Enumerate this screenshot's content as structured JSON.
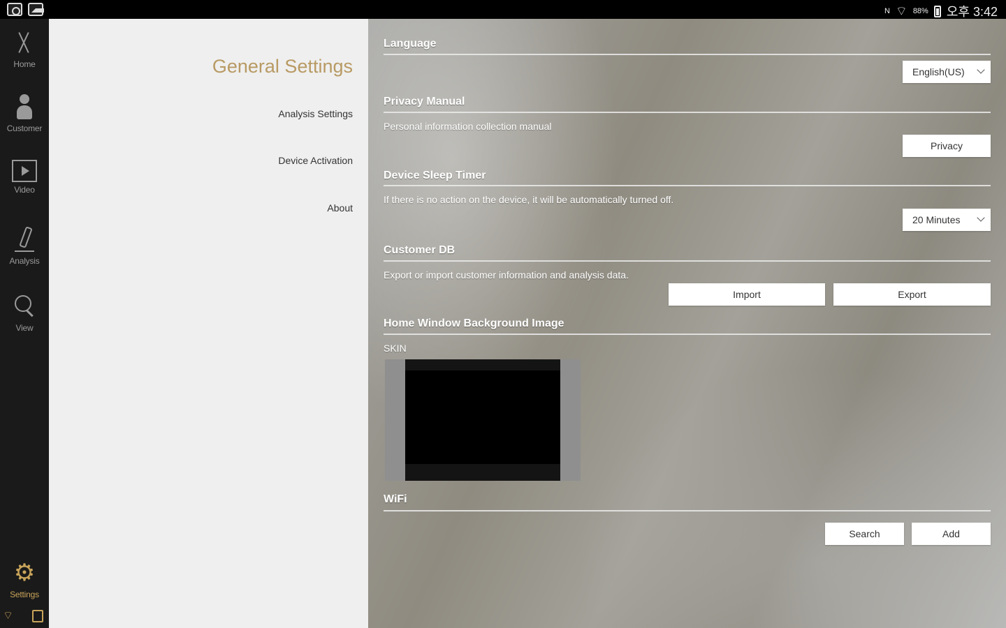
{
  "status_bar": {
    "network_label": "N",
    "battery_percent": "88%",
    "time": "오후 3:42"
  },
  "nav": {
    "items": [
      {
        "label": "Home",
        "icon": "scissors-icon"
      },
      {
        "label": "Customer",
        "icon": "person-icon"
      },
      {
        "label": "Video",
        "icon": "video-icon"
      },
      {
        "label": "Analysis",
        "icon": "microscope-icon"
      },
      {
        "label": "View",
        "icon": "magnifier-icon"
      }
    ],
    "settings": {
      "label": "Settings",
      "icon": "gear-icon"
    }
  },
  "menu": {
    "title": "General Settings",
    "items": [
      "Analysis Settings",
      "Device Activation",
      "About"
    ]
  },
  "sections": {
    "language": {
      "title": "Language",
      "value": "English(US)"
    },
    "privacy": {
      "title": "Privacy Manual",
      "desc": "Personal information collection manual",
      "button": "Privacy"
    },
    "sleep": {
      "title": "Device Sleep Timer",
      "desc": "If there is no action on the device, it will be automatically turned off.",
      "value": "20 Minutes"
    },
    "customer_db": {
      "title": "Customer DB",
      "desc": "Export or import customer information and analysis data.",
      "import_button": "Import",
      "export_button": "Export"
    },
    "background": {
      "title": "Home Window Background Image",
      "skin_label": "SKIN"
    },
    "wifi": {
      "title": "WiFi",
      "search_button": "Search",
      "add_button": "Add"
    }
  },
  "colors": {
    "accent": "#c9a45a",
    "menu_title": "#b89a63",
    "nav_bg": "#1a1a1a",
    "menu_bg": "#efefef"
  }
}
